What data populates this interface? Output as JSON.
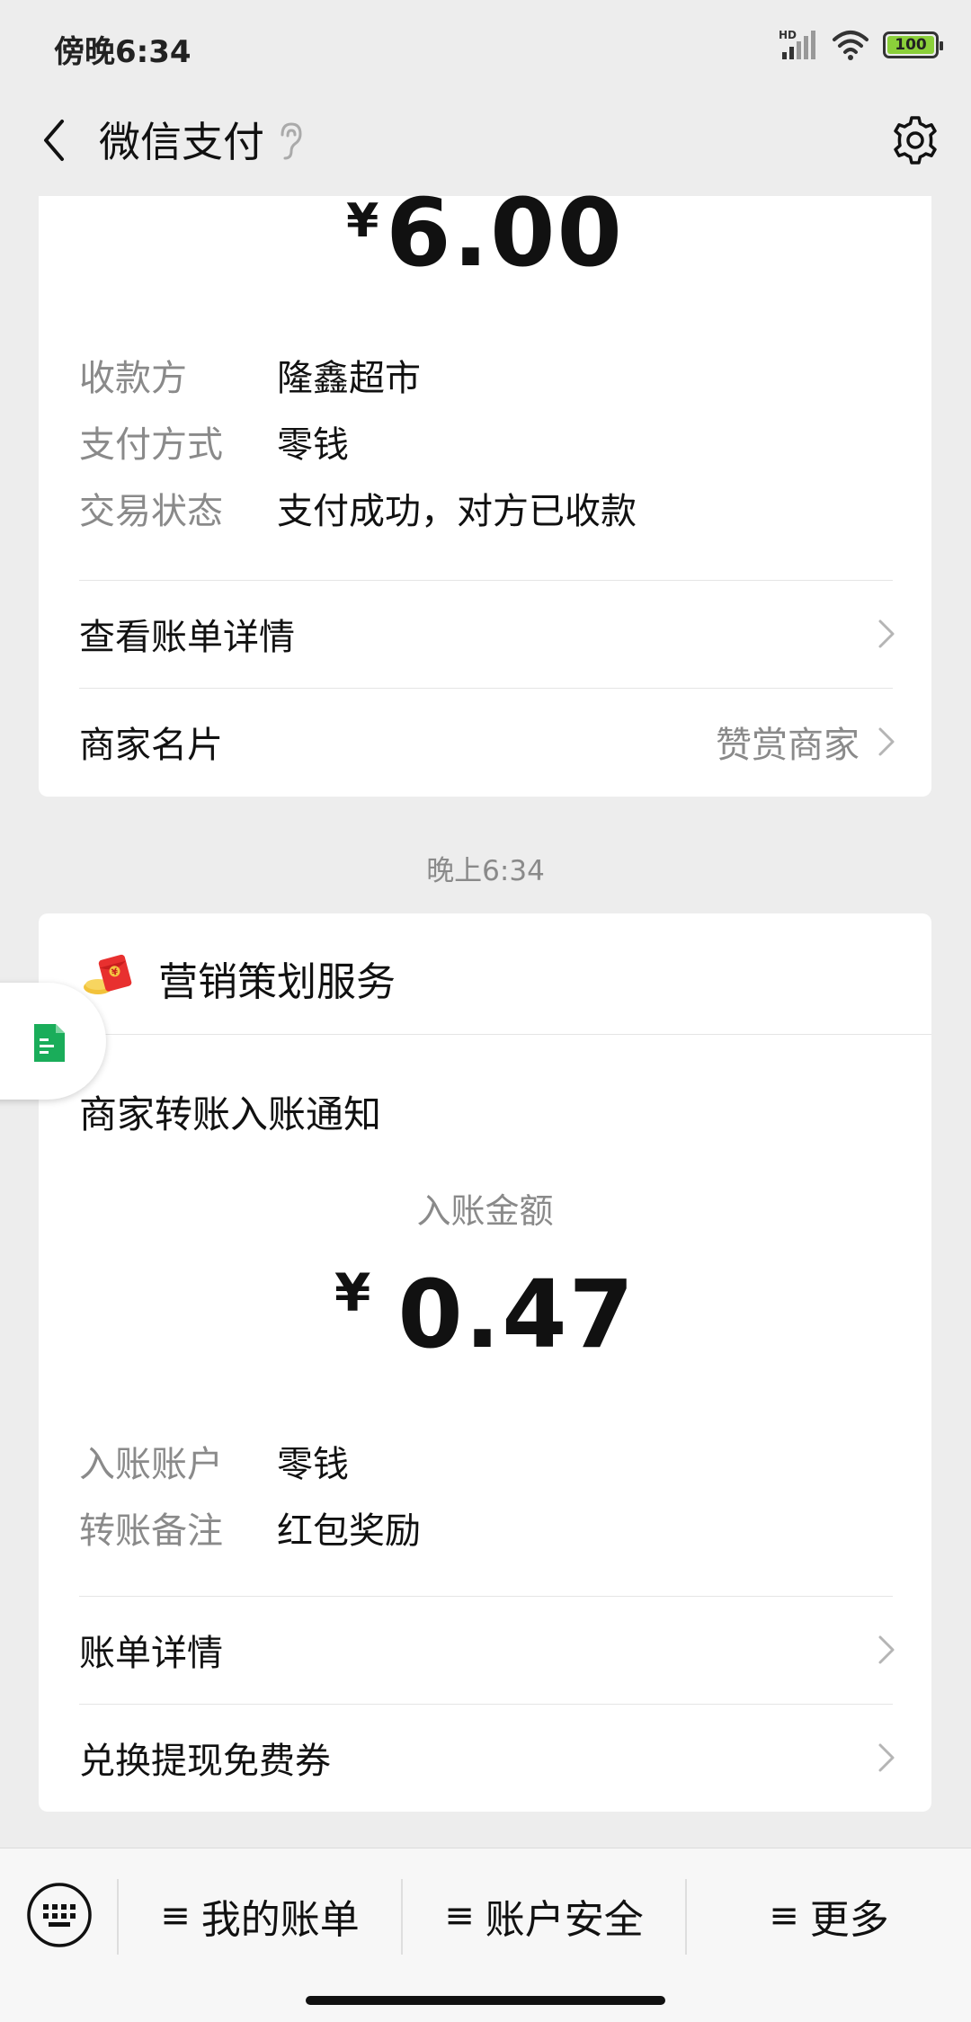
{
  "status_bar": {
    "time": "傍晚6:34",
    "battery": "100",
    "network": "HD"
  },
  "nav": {
    "title": "微信支付"
  },
  "payment": {
    "currency": "¥",
    "amount": "6.00",
    "fields": [
      {
        "key": "收款方",
        "value": "隆鑫超市"
      },
      {
        "key": "支付方式",
        "value": "零钱"
      },
      {
        "key": "交易状态",
        "value": "支付成功，对方已收款"
      }
    ],
    "links": [
      {
        "label": "查看账单详情",
        "hint": ""
      },
      {
        "label": "商家名片",
        "hint": "赞赏商家"
      }
    ]
  },
  "timestamp": "晚上6:34",
  "notice": {
    "service_name": "营销策划服务",
    "title": "商家转账入账通知",
    "amount_label": "入账金额",
    "currency": "¥",
    "amount": "0.47",
    "fields": [
      {
        "key": "入账账户",
        "value": "零钱"
      },
      {
        "key": "转账备注",
        "value": "红包奖励"
      }
    ],
    "links": [
      {
        "label": "账单详情"
      },
      {
        "label": "兑换提现免费券"
      }
    ]
  },
  "bottom_menu": {
    "items": [
      {
        "label": "我的账单"
      },
      {
        "label": "账户安全"
      },
      {
        "label": "更多"
      }
    ],
    "menu_glyph": "≡"
  },
  "colors": {
    "background": "#ededed",
    "card": "#ffffff",
    "secondary_text": "#8a8a8a",
    "accent_green": "#1aad5a",
    "battery_fill": "#8bd03a"
  }
}
